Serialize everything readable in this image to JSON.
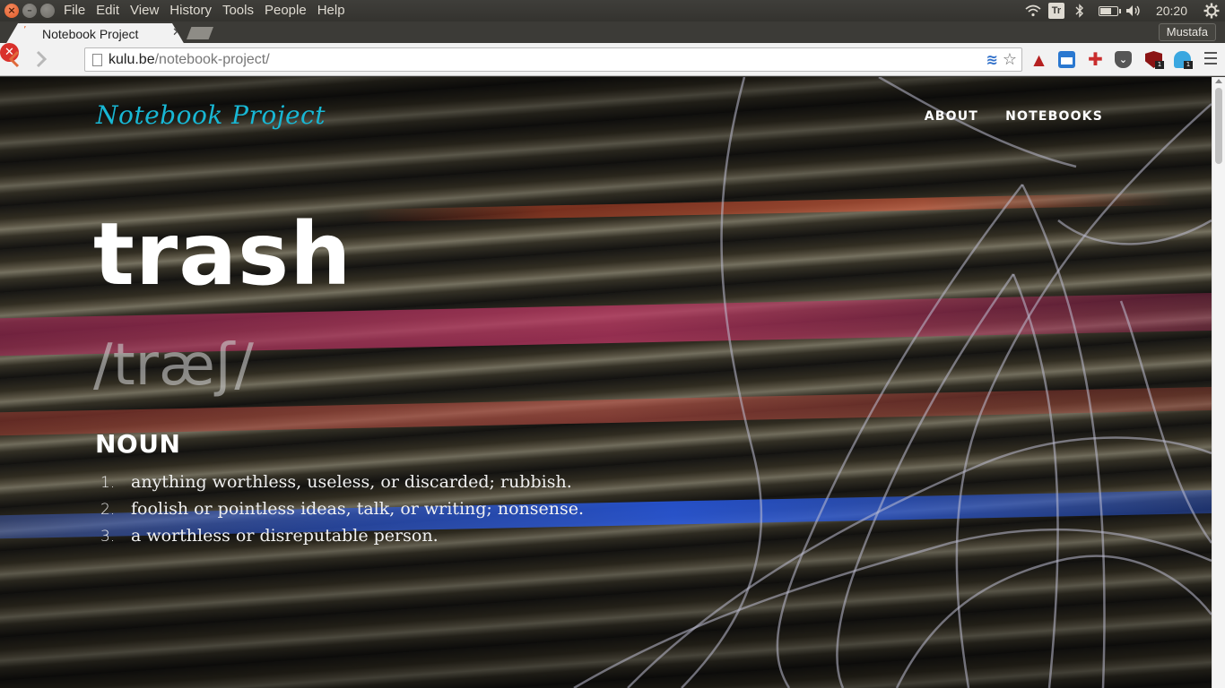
{
  "system": {
    "menus": [
      "File",
      "Edit",
      "View",
      "History",
      "Tools",
      "People",
      "Help"
    ],
    "tray_text": "Tr",
    "clock": "20:20"
  },
  "browser": {
    "tab_title": "Notebook Project",
    "profile": "Mustafa",
    "url_host": "kulu.be",
    "url_path": "/notebook-project/",
    "extension_badges": {
      "ublock": "1",
      "ghostery": "1"
    }
  },
  "page": {
    "brand": "Notebook Project",
    "nav": [
      "ABOUT",
      "NOTEBOOKS"
    ],
    "word": "trash",
    "pronunciation": "/træʃ/",
    "part_of_speech": "NOUN",
    "definitions": [
      {
        "num": "1.",
        "text": "anything worthless, useless, or discarded; rubbish."
      },
      {
        "num": "2.",
        "text": "foolish or pointless ideas, talk, or writing; nonsense."
      },
      {
        "num": "3.",
        "text": "a worthless or disreputable person."
      }
    ]
  },
  "colors": {
    "brand": "#18b7d4",
    "stop_button": "#d9312c",
    "back_arrow": "#e06a3b"
  }
}
